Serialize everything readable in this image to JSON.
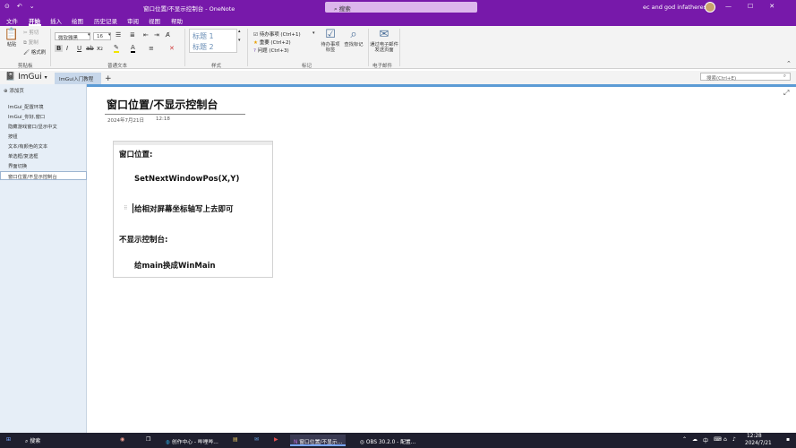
{
  "window": {
    "title": "窗口位置/不显示控制台 - OneNote",
    "search_placeholder": "搜索",
    "user": "ec and god infatheres R",
    "controls": [
      "—",
      "☐",
      "✕"
    ]
  },
  "menu": {
    "items": [
      "文件",
      "开始",
      "插入",
      "绘图",
      "历史记录",
      "审阅",
      "视图",
      "帮助"
    ],
    "active": "开始"
  },
  "ribbon": {
    "clipboard": {
      "paste": "粘贴",
      "cut": "剪切",
      "copy": "复制",
      "format_painter": "格式刷",
      "group": "剪贴板"
    },
    "font": {
      "family": "微软雅黑",
      "size": "16",
      "group": "普通文本"
    },
    "styles": {
      "h1": "标题 1",
      "h2": "标题 2",
      "group": "样式"
    },
    "tags": {
      "todo": "待办事项 (Ctrl+1)",
      "important": "重要 (Ctrl+2)",
      "question": "问题 (Ctrl+3)",
      "todo_tag": "待办事项标签",
      "find_tags": "查找标记",
      "group": "标记"
    },
    "email": {
      "label": "通过电子邮件发送页面",
      "group": "电子邮件"
    }
  },
  "notebook": {
    "name": "ImGui",
    "section": "ImGui入门教程",
    "add_section": "+",
    "search_placeholder": "搜索(Ctrl+E)"
  },
  "pages": {
    "add_page": "添加页",
    "items": [
      "ImGui_配置环境",
      "ImGui_你好,窗口",
      "隐藏游戏窗口/显示中文",
      "按钮",
      "文本/有颜色的文本",
      "单选框/复选框",
      "界面切换",
      "窗口位置/不显示控制台"
    ],
    "selected_index": 7
  },
  "note": {
    "title": "窗口位置/不显示控制台",
    "date": "2024年7月21日",
    "time": "12:18",
    "lines": [
      "窗口位置:",
      "SetNextWindowPos(X,Y)",
      "给相对屏幕坐标轴写上去即可",
      "不显示控制台:",
      "给main换成WinMain"
    ]
  },
  "taskbar": {
    "search": "搜索",
    "apps": [
      "创作中心 - 哔哩哔...",
      "窗口位置/不显示...",
      "OBS 30.2.0 - 配置..."
    ],
    "time": "12:28",
    "date": "2024/7/21",
    "lang": "中"
  }
}
